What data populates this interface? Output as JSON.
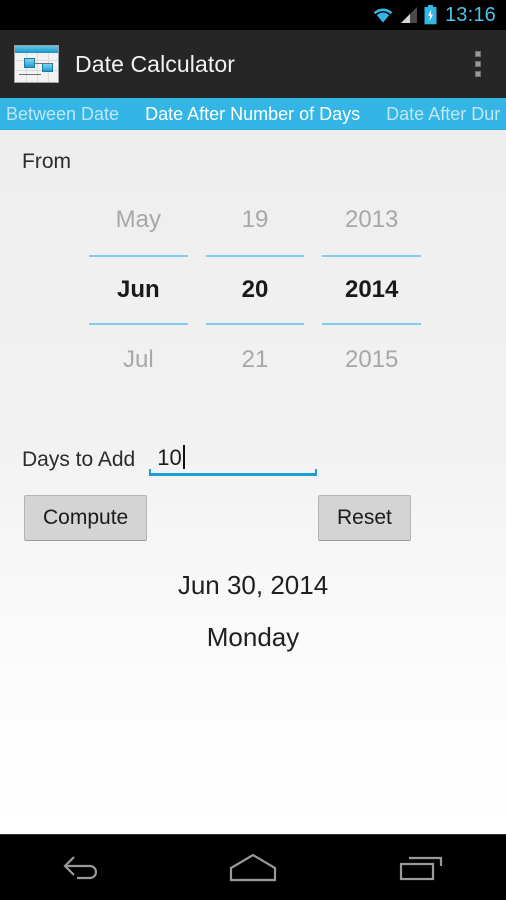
{
  "statusbar": {
    "time": "13:16",
    "icons": [
      "wifi-icon",
      "signal-icon",
      "battery-charging-icon"
    ],
    "accent_color": "#4cc2e8",
    "background": "#000000"
  },
  "actionbar": {
    "app_icon": "date-calculator-app-icon",
    "title": "Date Calculator",
    "overflow_icon": "overflow-menu-icon",
    "background": "#262626",
    "title_color": "#f2f2f2"
  },
  "tabs": {
    "background": "#33b5e5",
    "active_color": "#ffffff",
    "inactive_color": "#bfe7f6",
    "items": [
      {
        "label": "Between Date",
        "active": false
      },
      {
        "label": "Date After Number of Days",
        "active": true
      },
      {
        "label": "Date After Dur",
        "active": false
      }
    ]
  },
  "form": {
    "from_label": "From",
    "days_label": "Days to Add",
    "days_value": "10",
    "days_underline_color": "#1d9ed4"
  },
  "picker": {
    "divider_color": "#7ecdec",
    "columns": [
      {
        "name": "month-column",
        "previous": "May",
        "selected": "Jun",
        "next": "Jul"
      },
      {
        "name": "day-column",
        "previous": "19",
        "selected": "20",
        "next": "21"
      },
      {
        "name": "year-column",
        "previous": "2013",
        "selected": "2014",
        "next": "2015"
      }
    ]
  },
  "buttons": {
    "compute": "Compute",
    "reset": "Reset",
    "face_color": "#d4d4d4"
  },
  "result": {
    "date": "Jun 30, 2014",
    "weekday": "Monday"
  },
  "navbar": {
    "background": "#000000",
    "items": [
      "back-icon",
      "home-icon",
      "recents-icon"
    ]
  }
}
